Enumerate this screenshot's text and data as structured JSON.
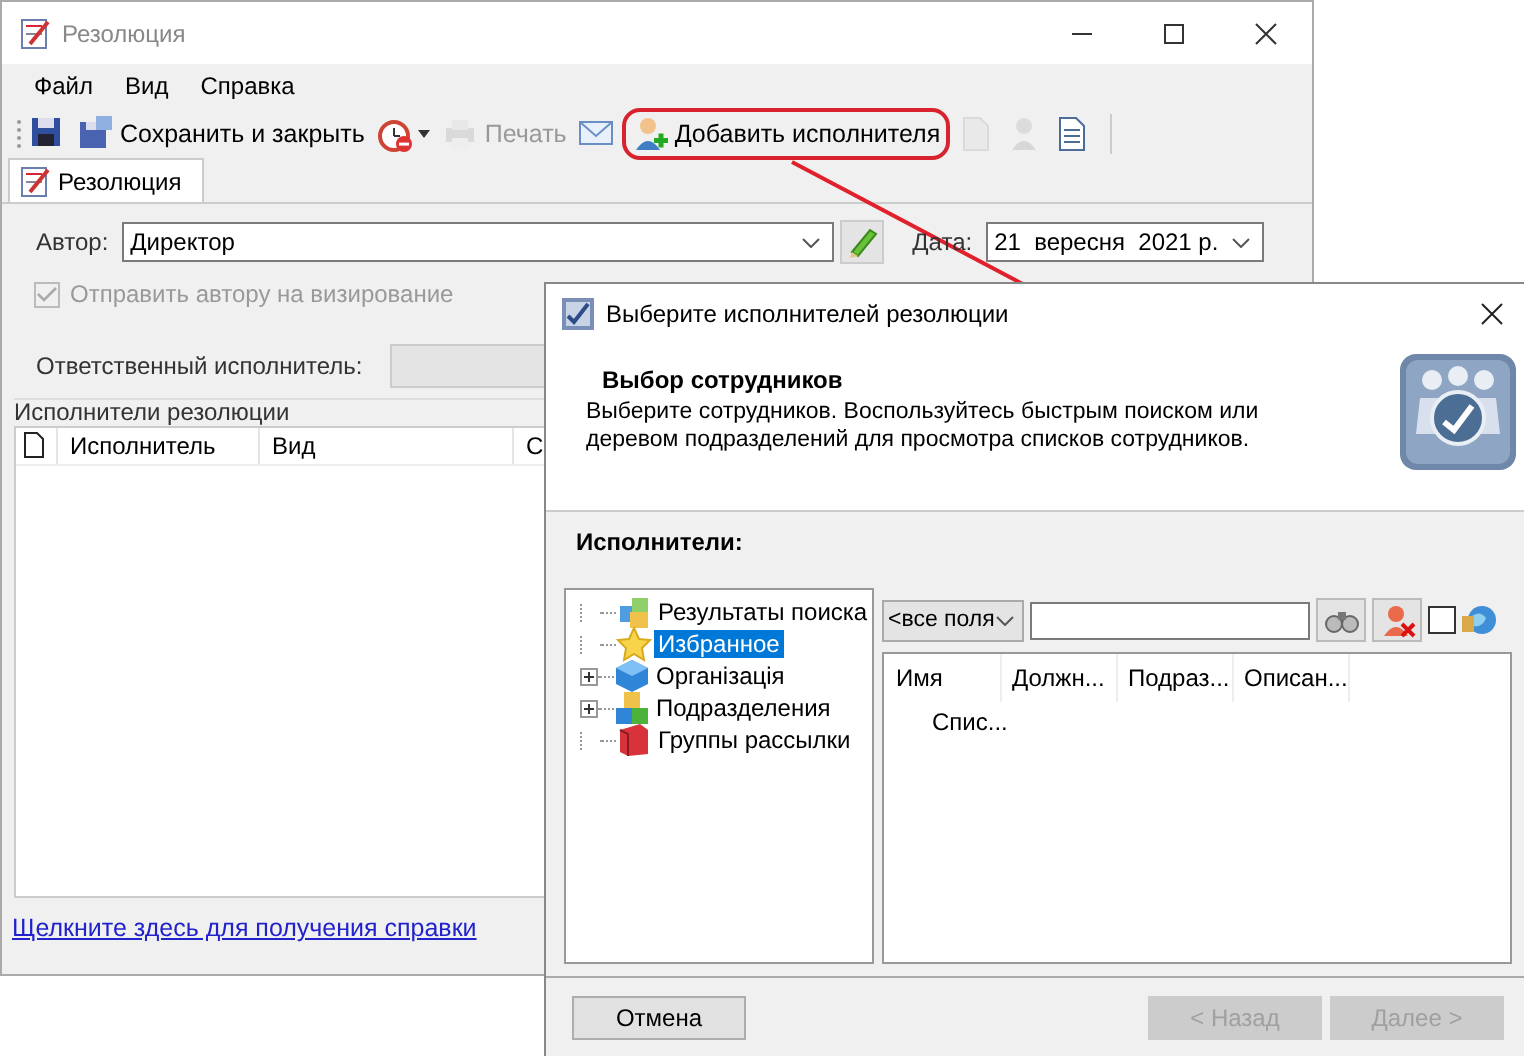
{
  "main_window": {
    "title": "Резолюция"
  },
  "menu": [
    "Файл",
    "Вид",
    "Справка"
  ],
  "toolbar": [
    {
      "kind": "icon",
      "disabled": false,
      "highlighted": false
    },
    {
      "kind": "labeled",
      "label": "Сохранить и закрыть",
      "disabled": false,
      "highlighted": false
    },
    {
      "kind": "dropdown",
      "disabled": false,
      "highlighted": false
    },
    {
      "kind": "labeled",
      "label": "Печать",
      "disabled": true,
      "highlighted": false
    },
    {
      "kind": "icon",
      "disabled": false,
      "highlighted": false
    },
    {
      "kind": "labeled",
      "label": "Добавить исполнителя",
      "disabled": false,
      "highlighted": true
    },
    {
      "kind": "icon",
      "disabled": true,
      "highlighted": false
    },
    {
      "kind": "icon",
      "disabled": true,
      "highlighted": false
    },
    {
      "kind": "icon",
      "disabled": false,
      "highlighted": false
    }
  ],
  "tabs": [
    {
      "label": "Резолюция",
      "selected": true
    }
  ],
  "form": {
    "author": {
      "label": "Автор:",
      "value": "Директор"
    },
    "date": {
      "label": "Дата:",
      "value": "21  вересня  2021 р."
    },
    "send_for_approval": {
      "label": "Отправить автору на визирование",
      "checked": true,
      "disabled": true
    },
    "responsible": {
      "label": "Ответственный исполнитель:"
    }
  },
  "executors": {
    "title": "Исполнители резолюции",
    "columns": [
      "Исполнитель",
      "Вид",
      "С"
    ]
  },
  "help_link": "Щелкните здесь для получения справки",
  "dialog": {
    "title": "Выберите исполнителей резолюции",
    "header": {
      "title": "Выбор сотрудников",
      "description": "Выберите сотрудников. Воспользуйтесь быстрым поиском или деревом подразделений для просмотра списков сотрудников."
    },
    "section_label": "Исполнители:",
    "tree": [
      {
        "label": "Результаты поиска",
        "selected": false
      },
      {
        "label": "Избранное",
        "selected": true
      },
      {
        "label": "Організація",
        "selected": false,
        "expanded": false
      },
      {
        "label": "Подразделения",
        "selected": false,
        "expanded": false
      },
      {
        "label": "Группы рассылки",
        "selected": false
      }
    ],
    "filter": {
      "value": "<все поля"
    },
    "search": {
      "checked": false
    },
    "list": {
      "columns": [
        "Имя",
        "Должн...",
        "Подраз...",
        "Описан..."
      ],
      "empty_text": "Спис..."
    },
    "buttons": [
      {
        "label": "Отмена",
        "disabled": false
      },
      {
        "label": "< Назад",
        "disabled": true
      },
      {
        "label": "Далее >",
        "disabled": true
      }
    ]
  }
}
